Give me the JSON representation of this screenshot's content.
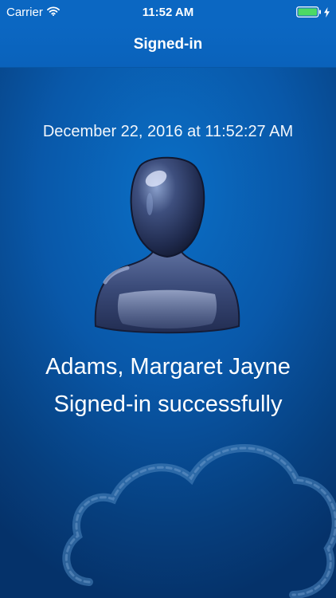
{
  "status_bar": {
    "carrier": "Carrier",
    "time": "11:52 AM"
  },
  "nav": {
    "title": "Signed-in"
  },
  "signin": {
    "timestamp": "December 22, 2016 at 11:52:27 AM",
    "user_name": "Adams, Margaret Jayne",
    "message": "Signed-in successfully"
  },
  "colors": {
    "nav_background": "#0b67c2",
    "screen_background": "#0958a9",
    "battery_fill": "#4cd964"
  },
  "icons": {
    "wifi": "wifi-icon",
    "battery": "battery-icon",
    "charging": "charging-bolt-icon",
    "avatar": "user-silhouette-icon",
    "cloud": "cloud-watermark-icon"
  }
}
